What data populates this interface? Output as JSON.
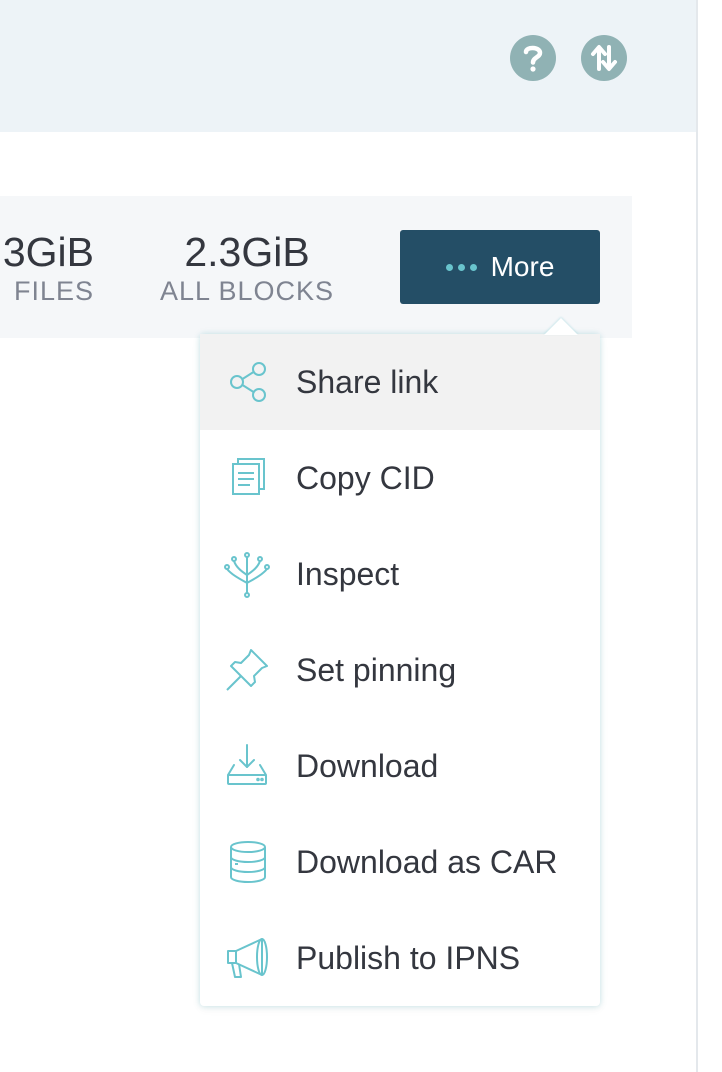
{
  "header": {
    "help_icon": "question-mark-icon",
    "transfer_icon": "up-down-arrows-icon"
  },
  "stats": {
    "files_value": "3GiB",
    "files_label": "FILES",
    "blocks_value": "2.3GiB",
    "blocks_label": "ALL BLOCKS"
  },
  "more_button": {
    "label": "More",
    "icon": "dots-icon"
  },
  "menu": {
    "items": [
      {
        "label": "Share link",
        "icon": "share-icon",
        "highlighted": true
      },
      {
        "label": "Copy CID",
        "icon": "copy-icon",
        "highlighted": false
      },
      {
        "label": "Inspect",
        "icon": "tree-icon",
        "highlighted": false
      },
      {
        "label": "Set pinning",
        "icon": "pin-icon",
        "highlighted": false
      },
      {
        "label": "Download",
        "icon": "download-icon",
        "highlighted": false
      },
      {
        "label": "Download as CAR",
        "icon": "database-icon",
        "highlighted": false
      },
      {
        "label": "Publish to IPNS",
        "icon": "megaphone-icon",
        "highlighted": false
      }
    ]
  },
  "colors": {
    "header_bg": "#edf3f7",
    "icon_button_bg": "#90b2b4",
    "more_button_bg": "#244e66",
    "accent": "#69c4cd",
    "text": "#34373f",
    "muted_text": "#7f8491"
  }
}
